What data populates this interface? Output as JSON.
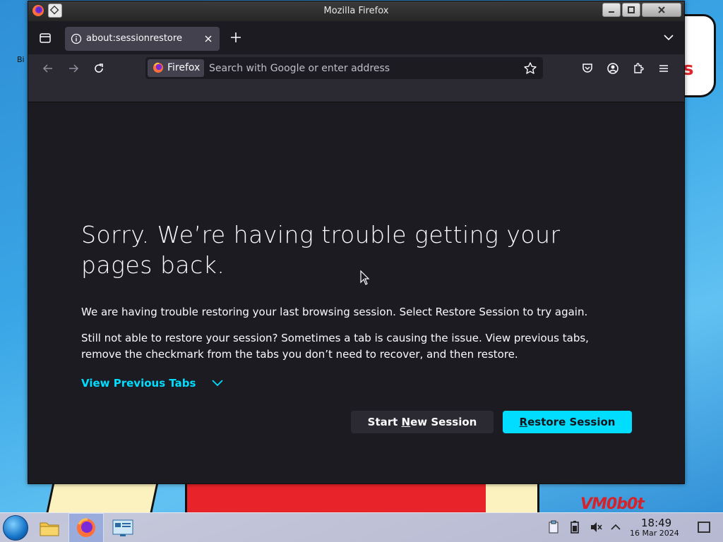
{
  "window": {
    "title": "Mozilla Firefox"
  },
  "tabs": [
    {
      "label": "about:sessionrestore"
    }
  ],
  "urlbar": {
    "identity_label": "Firefox",
    "placeholder": "Search with Google or enter address"
  },
  "content": {
    "heading": "Sorry. We’re having trouble getting your pages back.",
    "para1": "We are having trouble restoring your last browsing session. Select Restore Session to try again.",
    "para2": "Still not able to restore your session? Sometimes a tab is causing the issue. View previous tabs, remove the checkmark from the tabs you don’t need to recover, and then restore.",
    "view_previous_tabs": "View Previous Tabs",
    "start_new_session": {
      "before": "Start ",
      "accesskey": "N",
      "after": "ew Session"
    },
    "restore_session": {
      "before": "",
      "accesskey": "R",
      "after": "estore Session"
    }
  },
  "taskbar": {
    "clock_time": "18:49",
    "clock_date": "16 Mar 2024"
  },
  "desktop": {
    "left_icon_text": "Bi",
    "corner_text": "VM0b0t"
  },
  "colors": {
    "accent": "#00ddff",
    "content_bg": "#1c1b22",
    "toolbar_bg": "#2b2a33"
  }
}
